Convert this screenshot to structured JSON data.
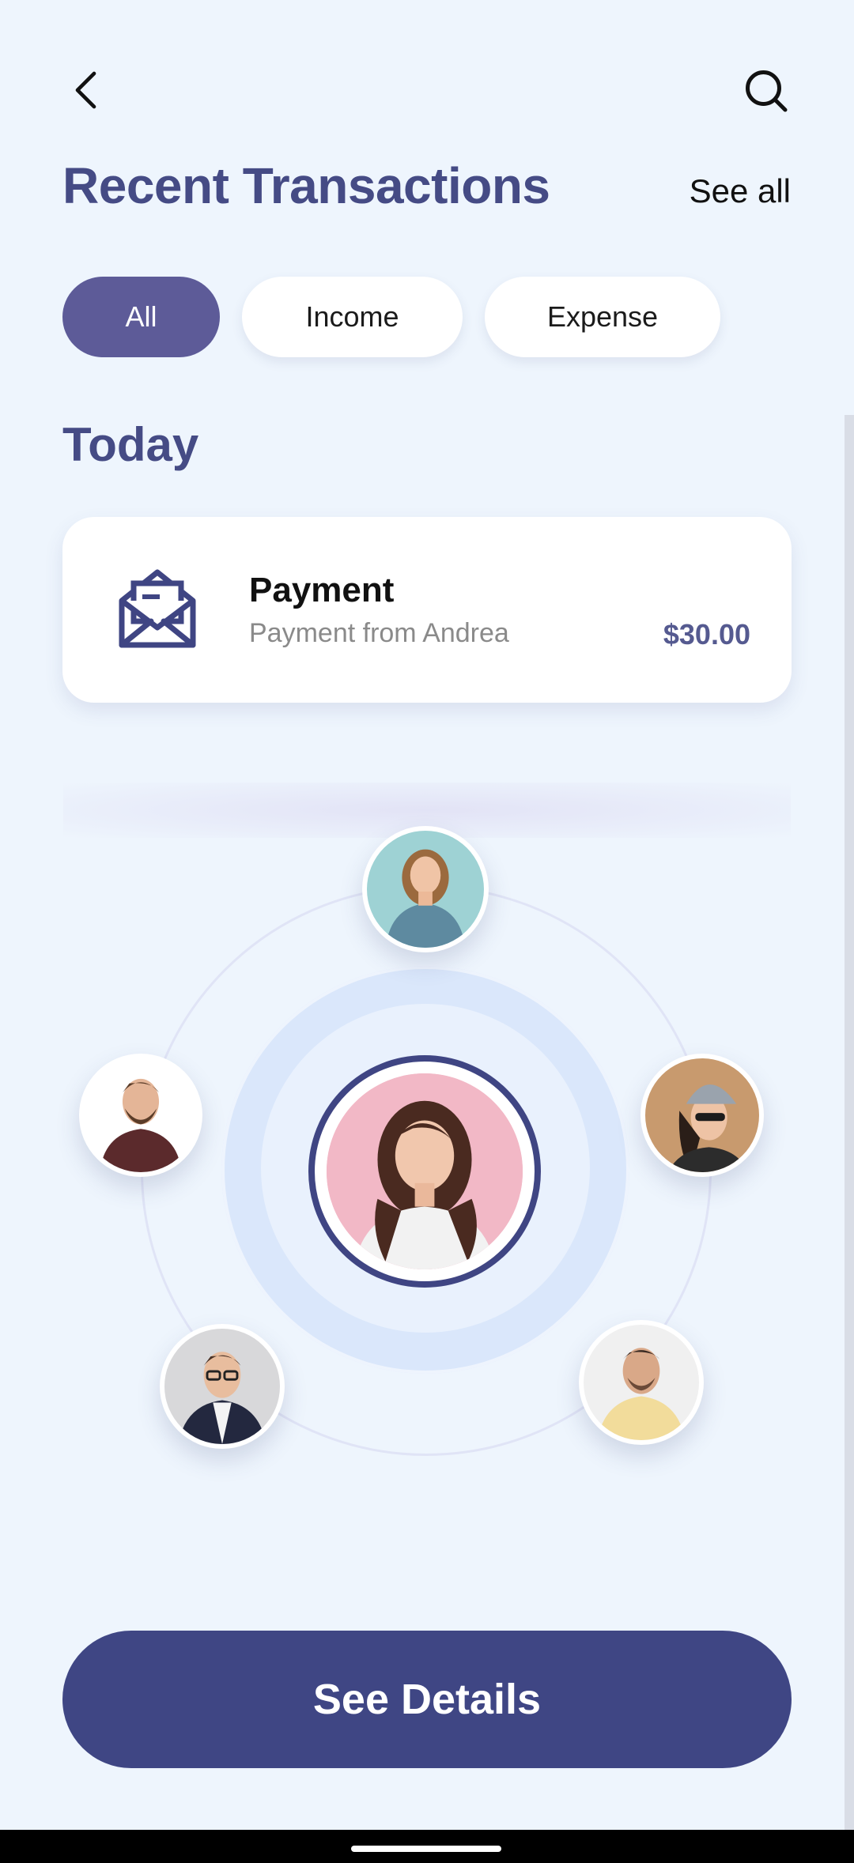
{
  "header": {
    "back_icon": "chevron-left-icon",
    "search_icon": "search-icon",
    "title": "Recent Transactions",
    "see_all": "See all"
  },
  "filters": [
    {
      "label": "All",
      "active": true
    },
    {
      "label": "Income",
      "active": false
    },
    {
      "label": "Expense",
      "active": false
    }
  ],
  "section": {
    "title": "Today"
  },
  "transaction": {
    "icon": "mail-open-icon",
    "title": "Payment",
    "subtitle": "Payment from Andrea",
    "amount": "$30.00"
  },
  "contacts": {
    "center": "avatar-woman-pink-background",
    "orbit": [
      "avatar-woman-teal-background",
      "avatar-man-beard",
      "avatar-woman-beanie",
      "avatar-man-glasses",
      "avatar-man-yellow-shirt"
    ]
  },
  "cta": {
    "label": "See Details"
  },
  "colors": {
    "background": "#eef5fd",
    "accent": "#454b85",
    "chip_active": "#5d5b98",
    "button": "#3f4684",
    "amount": "#555a90"
  }
}
